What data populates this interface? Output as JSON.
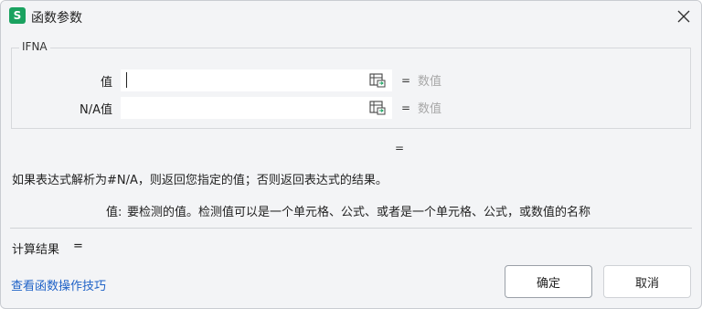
{
  "window": {
    "app_icon": "S",
    "title": "函数参数",
    "close_icon": "close-icon"
  },
  "group": {
    "title": "IFNA",
    "args": [
      {
        "label": "值",
        "value": "",
        "eq": "=",
        "hint": "数值",
        "ref_icon": "range-select-icon"
      },
      {
        "label": "N/A值",
        "value": "",
        "eq": "=",
        "hint": "数值",
        "ref_icon": "range-select-icon"
      }
    ]
  },
  "formula_result_eq": "=",
  "description": "如果表达式解析为#N/A，则返回您指定的值；否则返回表达式的结果。",
  "arg_help": {
    "name": "值:",
    "text": "要检测的值。检测值可以是一个单元格、公式、或者是一个单元格、公式，或数值的名称"
  },
  "calc_result": {
    "label": "计算结果",
    "eq": "="
  },
  "help_link": "查看函数操作技巧",
  "buttons": {
    "ok": "确定",
    "cancel": "取消"
  },
  "colors": {
    "accent": "#1aa260",
    "link": "#1f62c7",
    "hint": "#a8a8a8"
  }
}
